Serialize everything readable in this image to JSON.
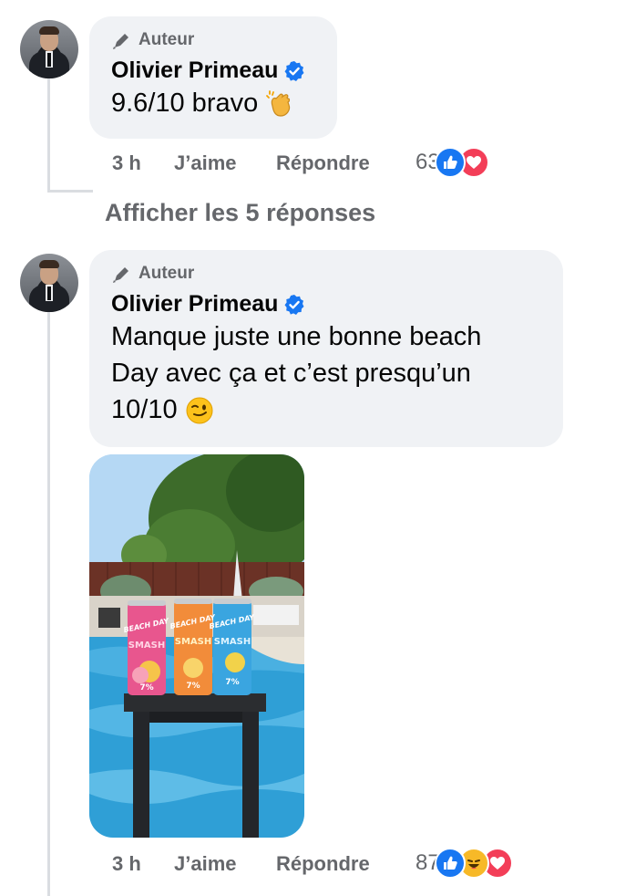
{
  "comments": [
    {
      "author_tag": "Auteur",
      "author_name": "Olivier Primeau",
      "text": "9.6/10 bravo",
      "emoji": "clapping-hands-emoji",
      "meta": {
        "time": "3 h",
        "like_label": "J’aime",
        "reply_label": "Répondre"
      },
      "reactions": {
        "count": "63",
        "types": [
          "like-icon",
          "love-icon"
        ]
      },
      "show_replies_label": "Afficher les 5 réponses"
    },
    {
      "author_tag": "Auteur",
      "author_name": "Olivier Primeau",
      "text_lines": [
        "Manque juste une bonne beach",
        "Day avec ça et c’est presqu’un",
        "10/10"
      ],
      "emoji": "winking-face-emoji",
      "attachment": {
        "type": "photo",
        "can_labels": [
          "BEACH DAY",
          "BEACH DAY",
          "BEACH DAY"
        ],
        "can_brand": "SMASH",
        "can_abv": "7%"
      },
      "meta": {
        "time": "3 h",
        "like_label": "J’aime",
        "reply_label": "Répondre"
      },
      "reactions": {
        "count": "87",
        "types": [
          "like-icon",
          "haha-icon",
          "love-icon"
        ]
      }
    }
  ],
  "colors": {
    "bubble": "#f0f2f5",
    "secondary_text": "#65676b",
    "verified": "#1877f2",
    "like": "#1877f2",
    "love": "#f33e58",
    "haha": "#f7b928"
  }
}
